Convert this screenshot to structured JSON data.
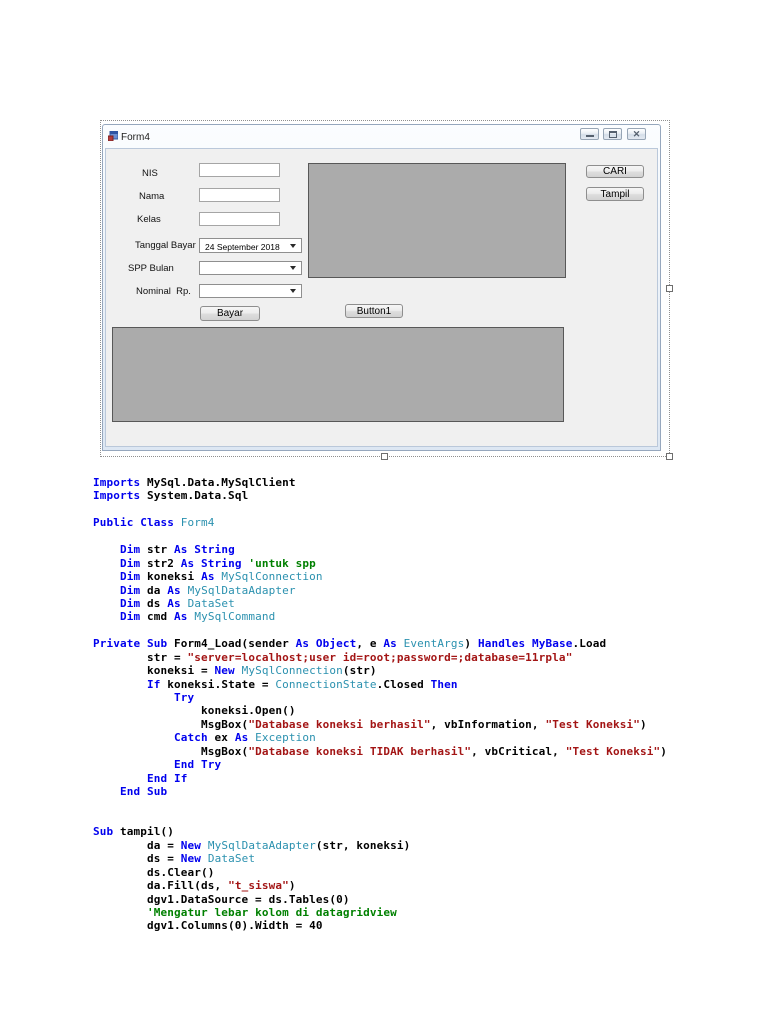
{
  "window": {
    "title": "Form4",
    "fields": [
      {
        "label": "NIS",
        "value": ""
      },
      {
        "label": "Nama",
        "value": ""
      },
      {
        "label": "Kelas",
        "value": ""
      },
      {
        "label": "Tanggal Bayar",
        "value": "24 September 2018"
      },
      {
        "label": "SPP Bulan",
        "value": ""
      },
      {
        "label": "Nominal  Rp.",
        "value": ""
      }
    ],
    "buttons": {
      "bayar": "Bayar",
      "button1": "Button1",
      "cari": "CARI",
      "tampil": "Tampil"
    }
  },
  "code": {
    "colors": {
      "keyword": "#0000ee",
      "type": "#2b91af",
      "string": "#a31515",
      "comment": "#008000",
      "plain": "#000000"
    },
    "lines": [
      [
        [
          "k",
          "Imports "
        ],
        [
          "p",
          "MySql.Data.MySqlClient"
        ]
      ],
      [
        [
          "k",
          "Imports "
        ],
        [
          "p",
          "System.Data.Sql"
        ]
      ],
      [],
      [
        [
          "k",
          "Public Class "
        ],
        [
          "t",
          "Form4"
        ]
      ],
      [],
      [
        [
          "p",
          "    "
        ],
        [
          "k",
          "Dim "
        ],
        [
          "p",
          "str "
        ],
        [
          "k",
          "As String"
        ]
      ],
      [
        [
          "p",
          "    "
        ],
        [
          "k",
          "Dim "
        ],
        [
          "p",
          "str2 "
        ],
        [
          "k",
          "As String "
        ],
        [
          "c",
          "'untuk spp"
        ]
      ],
      [
        [
          "p",
          "    "
        ],
        [
          "k",
          "Dim "
        ],
        [
          "p",
          "koneksi "
        ],
        [
          "k",
          "As "
        ],
        [
          "t",
          "MySqlConnection"
        ]
      ],
      [
        [
          "p",
          "    "
        ],
        [
          "k",
          "Dim "
        ],
        [
          "p",
          "da "
        ],
        [
          "k",
          "As "
        ],
        [
          "t",
          "MySqlDataAdapter"
        ]
      ],
      [
        [
          "p",
          "    "
        ],
        [
          "k",
          "Dim "
        ],
        [
          "p",
          "ds "
        ],
        [
          "k",
          "As "
        ],
        [
          "t",
          "DataSet"
        ]
      ],
      [
        [
          "p",
          "    "
        ],
        [
          "k",
          "Dim "
        ],
        [
          "p",
          "cmd "
        ],
        [
          "k",
          "As "
        ],
        [
          "t",
          "MySqlCommand"
        ]
      ],
      [],
      [
        [
          "k",
          "Private Sub "
        ],
        [
          "p",
          "Form4_Load(sender "
        ],
        [
          "k",
          "As Object"
        ],
        [
          "p",
          ", e "
        ],
        [
          "k",
          "As "
        ],
        [
          "t",
          "EventArgs"
        ],
        [
          "p",
          ") "
        ],
        [
          "k",
          "Handles MyBase"
        ],
        [
          "p",
          ".Load"
        ]
      ],
      [
        [
          "p",
          "        str = "
        ],
        [
          "s",
          "\"server=localhost;user id=root;password=;database=11rpla\""
        ]
      ],
      [
        [
          "p",
          "        koneksi = "
        ],
        [
          "k",
          "New "
        ],
        [
          "t",
          "MySqlConnection"
        ],
        [
          "p",
          "(str)"
        ]
      ],
      [
        [
          "p",
          "        "
        ],
        [
          "k",
          "If "
        ],
        [
          "p",
          "koneksi.State = "
        ],
        [
          "t",
          "ConnectionState"
        ],
        [
          "p",
          ".Closed "
        ],
        [
          "k",
          "Then"
        ]
      ],
      [
        [
          "p",
          "            "
        ],
        [
          "k",
          "Try"
        ]
      ],
      [
        [
          "p",
          "                koneksi.Open()"
        ]
      ],
      [
        [
          "p",
          "                MsgBox("
        ],
        [
          "s",
          "\"Database koneksi berhasil\""
        ],
        [
          "p",
          ", vbInformation, "
        ],
        [
          "s",
          "\"Test Koneksi\""
        ],
        [
          "p",
          ")"
        ]
      ],
      [
        [
          "p",
          "            "
        ],
        [
          "k",
          "Catch "
        ],
        [
          "p",
          "ex "
        ],
        [
          "k",
          "As "
        ],
        [
          "t",
          "Exception"
        ]
      ],
      [
        [
          "p",
          "                MsgBox("
        ],
        [
          "s",
          "\"Database koneksi TIDAK berhasil\""
        ],
        [
          "p",
          ", vbCritical, "
        ],
        [
          "s",
          "\"Test Koneksi\""
        ],
        [
          "p",
          ")"
        ]
      ],
      [
        [
          "p",
          "            "
        ],
        [
          "k",
          "End Try"
        ]
      ],
      [
        [
          "p",
          "        "
        ],
        [
          "k",
          "End If"
        ]
      ],
      [
        [
          "p",
          "    "
        ],
        [
          "k",
          "End Sub"
        ]
      ],
      [],
      [],
      [
        [
          "k",
          "Sub "
        ],
        [
          "p",
          "tampil()"
        ]
      ],
      [
        [
          "p",
          "        da = "
        ],
        [
          "k",
          "New "
        ],
        [
          "t",
          "MySqlDataAdapter"
        ],
        [
          "p",
          "(str, koneksi)"
        ]
      ],
      [
        [
          "p",
          "        ds = "
        ],
        [
          "k",
          "New "
        ],
        [
          "t",
          "DataSet"
        ]
      ],
      [
        [
          "p",
          "        ds.Clear()"
        ]
      ],
      [
        [
          "p",
          "        da.Fill(ds, "
        ],
        [
          "s",
          "\"t_siswa\""
        ],
        [
          "p",
          ")"
        ]
      ],
      [
        [
          "p",
          "        dgv1.DataSource = ds.Tables(0)"
        ]
      ],
      [
        [
          "p",
          "        "
        ],
        [
          "c",
          "'Mengatur lebar kolom di datagridview"
        ]
      ],
      [
        [
          "p",
          "        dgv1.Columns(0).Width = 40"
        ]
      ]
    ]
  }
}
